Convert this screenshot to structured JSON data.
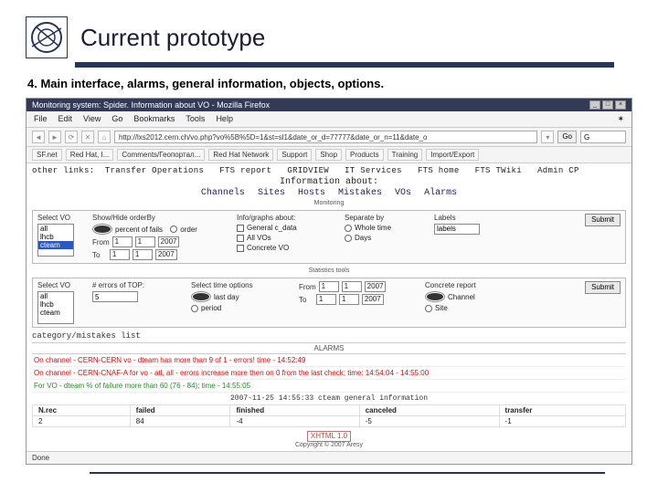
{
  "slide": {
    "title": "Current prototype",
    "subtitle": "4. Main interface, alarms, general information, objects, options."
  },
  "window": {
    "title": "Monitoring system: Spider. Information about VO - Mozilla Firefox",
    "minimize": "_",
    "maximize": "□",
    "close": "×"
  },
  "menu": {
    "file": "File",
    "edit": "Edit",
    "view": "View",
    "go": "Go",
    "bookmarks": "Bookmarks",
    "tools": "Tools",
    "help": "Help"
  },
  "nav": {
    "url": "http://lxs2012.cern.ch/vo.php?vo%5B%5D=1&st=sl1&date_or_d=77777&date_or_n=11&date_o",
    "go": "Go",
    "search_placeholder": "G"
  },
  "bookmarks": [
    "SF.net",
    "Red Hat, I...",
    "Comments/Геопортал...",
    "Red Hat Network",
    "Support",
    "Shop",
    "Products",
    "Training",
    "Import/Export"
  ],
  "page": {
    "otherlinks_label": "other links:",
    "otherlinks": [
      "Transfer Operations",
      "FTS report",
      "GRIDVIEW",
      "IT Services",
      "FTS home",
      "FTS TWiki",
      "Admin CP"
    ],
    "info_about": "Information about:",
    "navs": [
      "Channels",
      "Sites",
      "Hosts",
      "Mistakes",
      "VOs",
      "Alarms"
    ],
    "monitoring": "Monitoring",
    "statistics": "Statistics tools",
    "catlist": "category/mistakes list",
    "alarms_head": "ALARMS",
    "alarms": [
      {
        "cls": "red",
        "text": "On channel - CERN-CERN vo - dteam has more than 9 of 1 - errors! time - 14:52:49"
      },
      {
        "cls": "red",
        "text": "On channel - CERN-CNAF-A for vo - atl, all - errors increase more then on 0 from the last check; time: 14:54:04 - 14:55:00"
      },
      {
        "cls": "green",
        "text": "For VO - dteam % of failure more than 60 (76 - 84); time - 14:55:05"
      }
    ],
    "stamp": "2007-11-25 14:55:33 cteam general information",
    "table": {
      "headers": [
        "N.rec",
        "failed",
        "finished",
        "canceled",
        "transfer"
      ],
      "row": [
        "2",
        "84",
        "-4",
        "-5",
        "-1"
      ]
    },
    "copyright": "Copyright © 2007 Aresy",
    "xhtml": "XHTML 1.0"
  },
  "panel1": {
    "select_vo": "Select VO",
    "vo_items": [
      "all",
      "lhcb",
      "cteam"
    ],
    "sort_label": "Show/Hide orderBy",
    "rb_percent": "percent of fails",
    "rb_order": "order",
    "from": "From",
    "to": "To",
    "sel1": "1",
    "sel2": "1",
    "sel3": "2007",
    "sel4": "1",
    "sel5": "1",
    "sel6": "2007",
    "info_label": "Info/graphs about:",
    "cb1": "General c_data",
    "cb2": "All VOs",
    "cb3": "Concrete VO",
    "sep_label": "Separate by",
    "sep_rb1": "Whole time",
    "sep_rb2": "Days",
    "color_label": "Labels",
    "color_sel": "labels",
    "submit": "Submit"
  },
  "panel2": {
    "select_vo": "Select VO",
    "vo_items": [
      "all",
      "lhcb",
      "cteam"
    ],
    "err_label": "# errors of TOP:",
    "err_val": "5",
    "time_label": "Select time options",
    "rb_last": "last day",
    "rb_period": "period",
    "from": "From",
    "to": "To",
    "sel1": "1",
    "sel2": "1",
    "sel3": "2007",
    "sel4": "1",
    "sel5": "1",
    "sel6": "2007",
    "conc_label": "Concrete report",
    "rb_channel": "Channel",
    "rb_site": "Site",
    "submit": "Submit"
  },
  "status": {
    "done": "Done"
  }
}
